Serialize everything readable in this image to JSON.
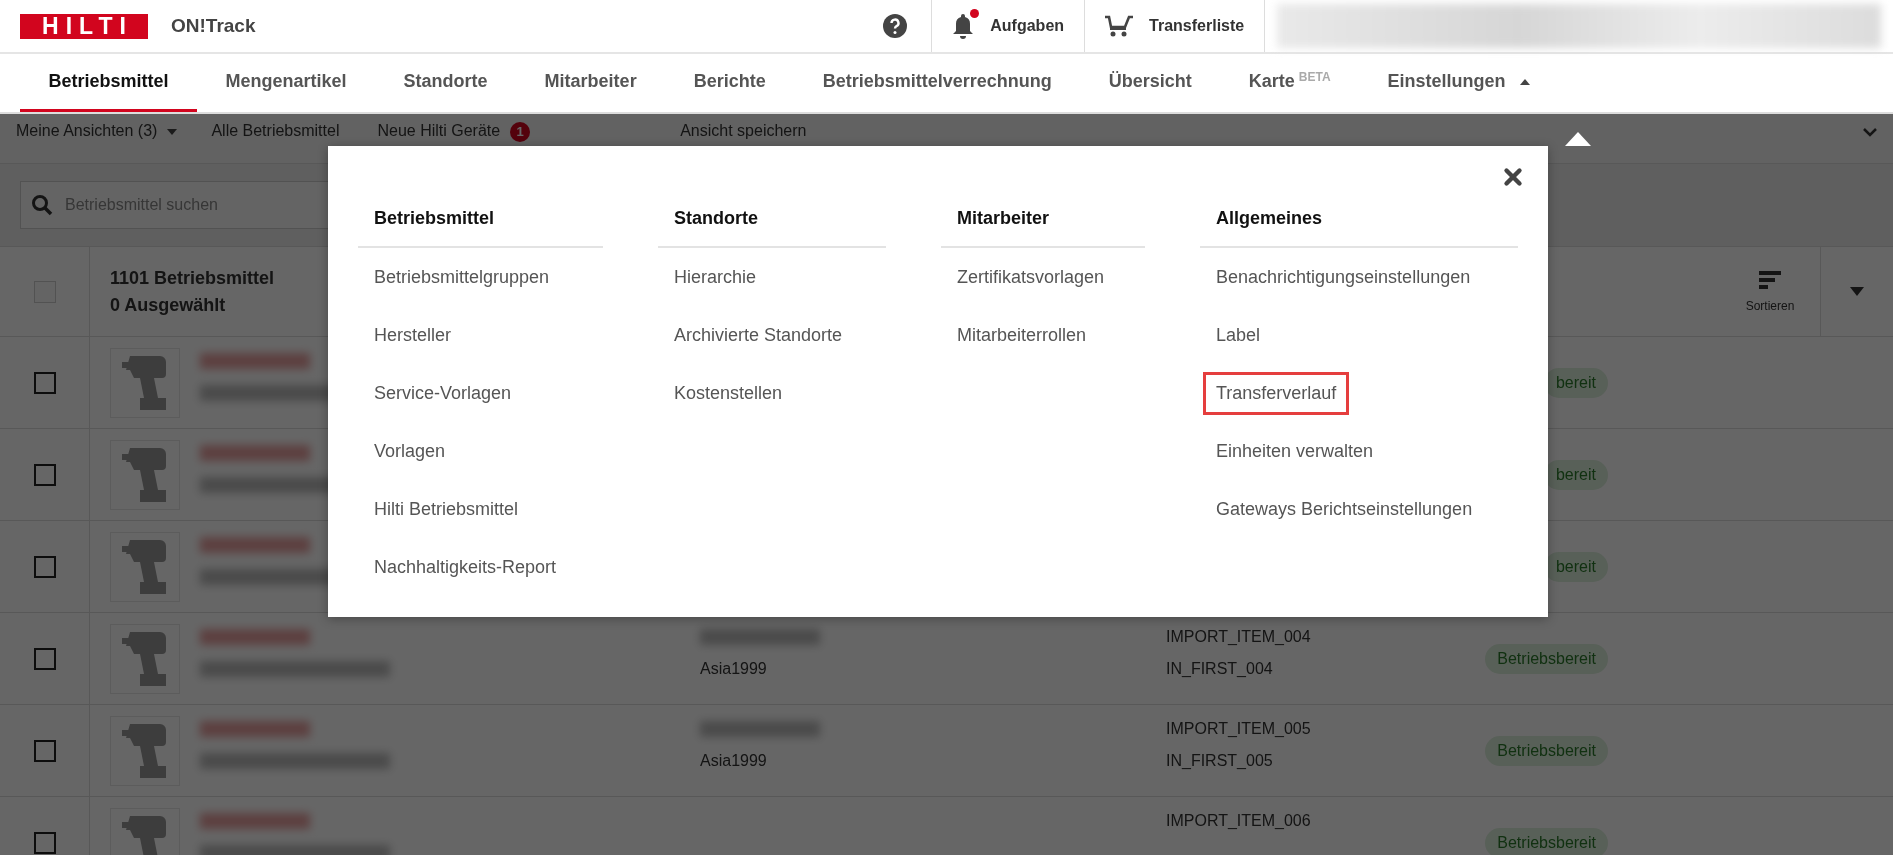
{
  "header": {
    "logo": "HILTI",
    "app_name": "ON!Track",
    "tasks_label": "Aufgaben",
    "tasks_notification": true,
    "transfer_label": "Transferliste"
  },
  "nav": {
    "tabs": [
      {
        "label": "Betriebsmittel",
        "selected": true
      },
      {
        "label": "Mengenartikel",
        "selected": false
      },
      {
        "label": "Standorte",
        "selected": false
      },
      {
        "label": "Mitarbeiter",
        "selected": false
      },
      {
        "label": "Berichte",
        "selected": false
      },
      {
        "label": "Betriebsmittelverrechnung",
        "selected": false
      },
      {
        "label": "Übersicht",
        "selected": false
      },
      {
        "label": "Karte",
        "selected": false,
        "sup": "BETA"
      },
      {
        "label": "Einstellungen",
        "selected": false,
        "expanded": true
      }
    ]
  },
  "toolbar": {
    "views": "Meine Ansichten (3)",
    "all": "Alle Betriebsmittel",
    "new": "Neue Hilti Geräte",
    "new_count": "1",
    "save": "Ansicht speichern"
  },
  "search": {
    "placeholder": "Betriebsmittel suchen"
  },
  "list": {
    "all_checked": false,
    "count": "1101 Betriebsmittel",
    "selected_count": "0 Ausgewählt",
    "sort_label": "Sortieren",
    "rows": [
      {
        "checked": false,
        "status": "bereit"
      },
      {
        "checked": false,
        "status": "bereit"
      },
      {
        "checked": false,
        "status": "bereit"
      },
      {
        "checked": false,
        "location": "Asia1999",
        "code": "IMPORT_ITEM_004",
        "name": "IN_FIRST_004",
        "status": "Betriebsbereit"
      },
      {
        "checked": false,
        "location": "Asia1999",
        "code": "IMPORT_ITEM_005",
        "name": "IN_FIRST_005",
        "status": "Betriebsbereit"
      },
      {
        "checked": false,
        "code": "IMPORT_ITEM_006",
        "status": "Betriebsbereit"
      }
    ]
  },
  "settings_menu": {
    "columns": [
      {
        "title": "Betriebsmittel",
        "items": [
          {
            "label": "Betriebsmittelgruppen",
            "highlighted": false
          },
          {
            "label": "Hersteller",
            "highlighted": false
          },
          {
            "label": "Service-Vorlagen",
            "highlighted": false
          },
          {
            "label": "Vorlagen",
            "highlighted": false
          },
          {
            "label": "Hilti Betriebsmittel",
            "highlighted": false
          },
          {
            "label": "Nachhaltigkeits-Report",
            "highlighted": false
          }
        ]
      },
      {
        "title": "Standorte",
        "items": [
          {
            "label": "Hierarchie",
            "highlighted": false
          },
          {
            "label": "Archivierte Standorte",
            "highlighted": false
          },
          {
            "label": "Kostenstellen",
            "highlighted": false
          }
        ]
      },
      {
        "title": "Mitarbeiter",
        "items": [
          {
            "label": "Zertifikatsvorlagen",
            "highlighted": false
          },
          {
            "label": "Mitarbeiterrollen",
            "highlighted": false
          }
        ]
      },
      {
        "title": "Allgemeines",
        "items": [
          {
            "label": "Benachrichtigungseinstellungen",
            "highlighted": false
          },
          {
            "label": "Label",
            "highlighted": false
          },
          {
            "label": "Transferverlauf",
            "highlighted": true
          },
          {
            "label": "Einheiten verwalten",
            "highlighted": false
          },
          {
            "label": "Gateways Berichtseinstellungen",
            "highlighted": false
          }
        ]
      }
    ]
  }
}
